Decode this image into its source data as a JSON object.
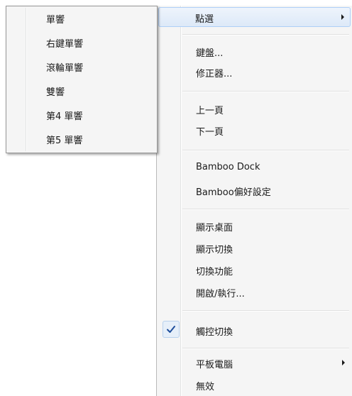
{
  "main_menu": {
    "items": [
      {
        "label": "點選",
        "has_submenu": true,
        "highlighted": true
      },
      {
        "label": "鍵盤..."
      },
      {
        "label": "修正器..."
      },
      {
        "label": "上一頁"
      },
      {
        "label": "下一頁"
      },
      {
        "label": "Bamboo Dock"
      },
      {
        "label": "Bamboo偏好設定"
      },
      {
        "label": "顯示桌面"
      },
      {
        "label": "顯示切換"
      },
      {
        "label": "切換功能"
      },
      {
        "label": "開啟/執行..."
      },
      {
        "label": "觸控切換",
        "checked": true
      },
      {
        "label": "平板電腦",
        "has_submenu": true
      },
      {
        "label": "無效"
      }
    ]
  },
  "sub_menu": {
    "items": [
      {
        "label": "單響"
      },
      {
        "label": "右鍵單響"
      },
      {
        "label": "滾輪單響"
      },
      {
        "label": "雙響"
      },
      {
        "label": "第4 單響"
      },
      {
        "label": "第5 單響"
      }
    ]
  },
  "colors": {
    "menu_bg": "#f5f5f5",
    "highlight_border": "#aecff7",
    "check_color": "#1e4e9c"
  }
}
